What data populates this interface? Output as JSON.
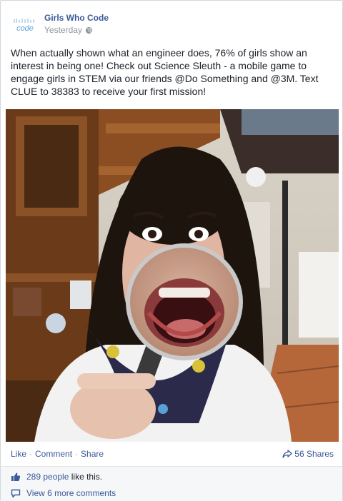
{
  "colors": {
    "link_blue": "#3b5998",
    "muted_gray": "#90949c",
    "text": "#1d2129",
    "logo_blue": "#5aa6d6"
  },
  "post": {
    "page_name": "Girls Who Code",
    "logo_text": "code",
    "timestamp": "Yesterday",
    "privacy_icon": "globe-icon",
    "text": "When actually shown what an engineer does, 76% of girls show an interest in being one! Check out Science Sleuth - a mobile game to engage girls in STEM via our friends @Do Something and @3M. Text CLUE to 38383 to receive your first mission!",
    "photo_icon": "photo-girl-magnifier"
  },
  "actions": {
    "like": "Like",
    "comment": "Comment",
    "share": "Share",
    "separator": "·",
    "shares_count": "56 Shares",
    "shares_icon": "share-arrow-icon"
  },
  "feedback": {
    "likes_prefix": "289 people",
    "likes_suffix": "like this.",
    "likes_icon": "thumbs-up-icon",
    "comments_label": "View 6 more comments",
    "comments_icon": "comment-bubble-icon"
  }
}
